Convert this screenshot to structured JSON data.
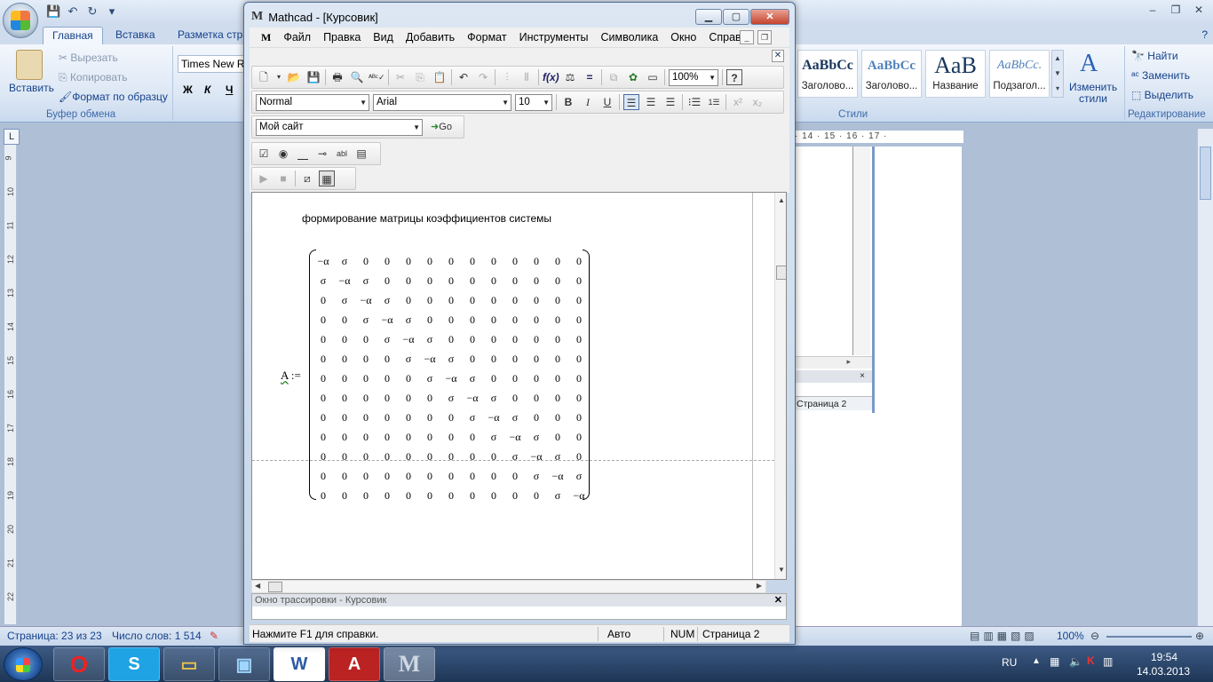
{
  "word": {
    "tabs": [
      "Главная",
      "Вставка",
      "Разметка стра"
    ],
    "clipboard": {
      "paste": "Вставить",
      "cut": "Вырезать",
      "copy": "Копировать",
      "format_painter": "Формат по образцу",
      "group": "Буфер обмена"
    },
    "font": {
      "name": "Times New Ro",
      "bold": "Ж",
      "italic": "К",
      "underline": "Ч"
    },
    "styles": {
      "group": "Стили",
      "items": [
        {
          "sample": "AaBbCc",
          "name": "Заголово..."
        },
        {
          "sample": "AaBbCc",
          "name": "Заголово..."
        },
        {
          "sample": "AaB",
          "name": "Название"
        },
        {
          "sample": "AaBbCc.",
          "name": "Подзагол..."
        }
      ],
      "change": "Изменить стили"
    },
    "editing": {
      "group": "Редактирование",
      "find": "Найти",
      "replace": "Заменить",
      "select": "Выделить"
    },
    "ruler_ticks": "· 14 · 15 · 16 · 17 ·",
    "embedded_status": "Страница 2",
    "status": {
      "page": "Страница: 23 из 23",
      "words": "Число слов: 1 514",
      "zoom": "100%"
    }
  },
  "mathcad": {
    "title": "Mathcad - [Курсовик]",
    "menu": [
      "Файл",
      "Правка",
      "Вид",
      "Добавить",
      "Формат",
      "Инструменты",
      "Символика",
      "Окно",
      "Справка"
    ],
    "zoom": "100%",
    "style_combo": "Normal",
    "font_combo": "Arial",
    "size_combo": "10",
    "url_combo": "Мой сайт",
    "go_label": "Go",
    "heading": "формирование матрицы коэффициентов системы",
    "matrix_label": "A",
    "assign_op": ":=",
    "matrix": [
      [
        "−α",
        "σ",
        "0",
        "0",
        "0",
        "0",
        "0",
        "0",
        "0",
        "0",
        "0",
        "0",
        "0"
      ],
      [
        "σ",
        "−α",
        "σ",
        "0",
        "0",
        "0",
        "0",
        "0",
        "0",
        "0",
        "0",
        "0",
        "0"
      ],
      [
        "0",
        "σ",
        "−α",
        "σ",
        "0",
        "0",
        "0",
        "0",
        "0",
        "0",
        "0",
        "0",
        "0"
      ],
      [
        "0",
        "0",
        "σ",
        "−α",
        "σ",
        "0",
        "0",
        "0",
        "0",
        "0",
        "0",
        "0",
        "0"
      ],
      [
        "0",
        "0",
        "0",
        "σ",
        "−α",
        "σ",
        "0",
        "0",
        "0",
        "0",
        "0",
        "0",
        "0"
      ],
      [
        "0",
        "0",
        "0",
        "0",
        "σ",
        "−α",
        "σ",
        "0",
        "0",
        "0",
        "0",
        "0",
        "0"
      ],
      [
        "0",
        "0",
        "0",
        "0",
        "0",
        "σ",
        "−α",
        "σ",
        "0",
        "0",
        "0",
        "0",
        "0"
      ],
      [
        "0",
        "0",
        "0",
        "0",
        "0",
        "0",
        "σ",
        "−α",
        "σ",
        "0",
        "0",
        "0",
        "0"
      ],
      [
        "0",
        "0",
        "0",
        "0",
        "0",
        "0",
        "0",
        "σ",
        "−α",
        "σ",
        "0",
        "0",
        "0"
      ],
      [
        "0",
        "0",
        "0",
        "0",
        "0",
        "0",
        "0",
        "0",
        "σ",
        "−α",
        "σ",
        "0",
        "0"
      ],
      [
        "0",
        "0",
        "0",
        "0",
        "0",
        "0",
        "0",
        "0",
        "0",
        "σ",
        "−α",
        "σ",
        "0"
      ],
      [
        "0",
        "0",
        "0",
        "0",
        "0",
        "0",
        "0",
        "0",
        "0",
        "0",
        "σ",
        "−α",
        "σ"
      ],
      [
        "0",
        "0",
        "0",
        "0",
        "0",
        "0",
        "0",
        "0",
        "0",
        "0",
        "0",
        "σ",
        "−α"
      ]
    ],
    "trace_title": "Окно трассировки - Курсовик",
    "status": {
      "help": "Нажмите F1 для справки.",
      "auto": "Авто",
      "num": "NUM",
      "page": "Страница 2"
    }
  },
  "taskbar": {
    "lang": "RU",
    "time": "19:54",
    "date": "14.03.2013"
  },
  "colors": {
    "accent": "#15428b",
    "taskbar": "#1e3656"
  }
}
